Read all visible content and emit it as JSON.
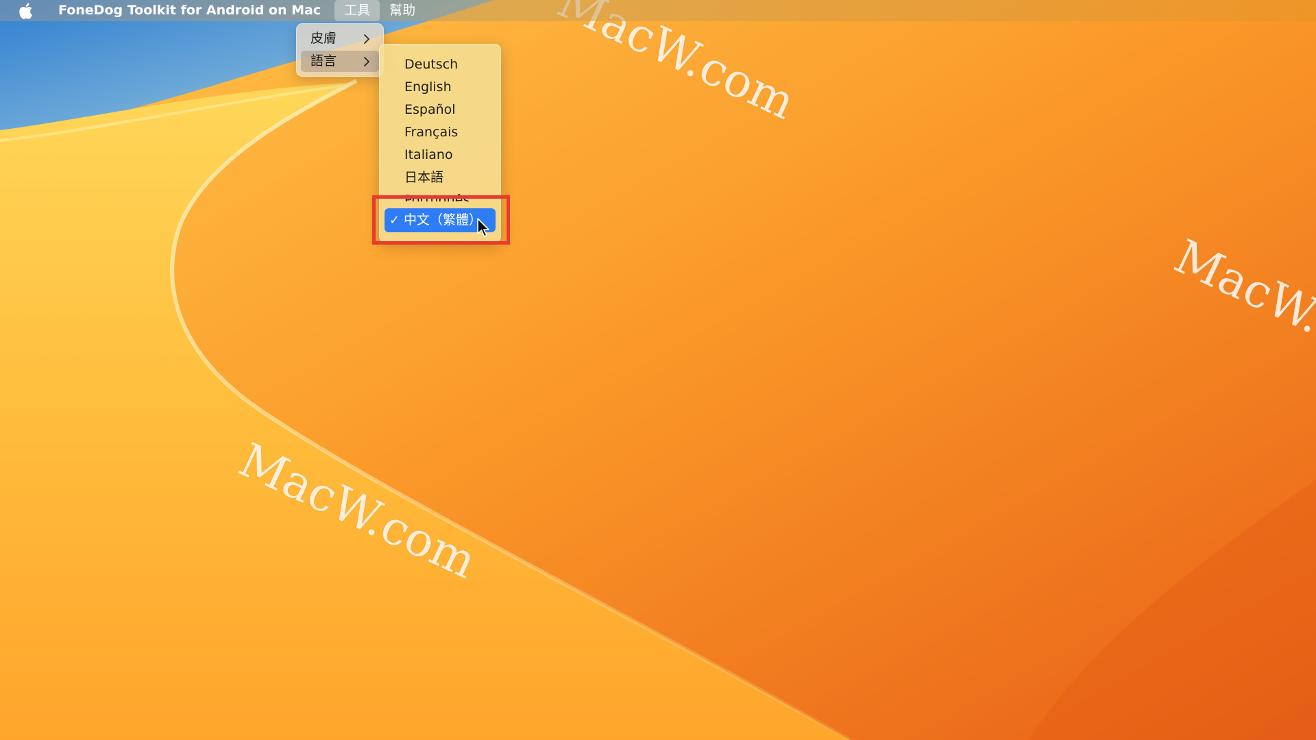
{
  "menubar": {
    "app_name": "FoneDog Toolkit for Android on Mac",
    "items": [
      {
        "label": "工具",
        "open": true
      },
      {
        "label": "幫助",
        "open": false
      }
    ]
  },
  "tools_menu": {
    "items": [
      {
        "label": "皮膚",
        "has_submenu": true,
        "highlighted": false
      },
      {
        "label": "語言",
        "has_submenu": true,
        "highlighted": true
      }
    ]
  },
  "language_menu": {
    "items": [
      "Deutsch",
      "English",
      "Español",
      "Français",
      "Italiano",
      "日本語",
      "Português"
    ],
    "selected": {
      "label": "中文（繁體）",
      "check": "✓"
    }
  },
  "watermarks": [
    "MacW.com",
    "MacW.com",
    "MacW.com"
  ],
  "colors": {
    "selection": "#2f7df6",
    "callout": "#e63b2e"
  }
}
